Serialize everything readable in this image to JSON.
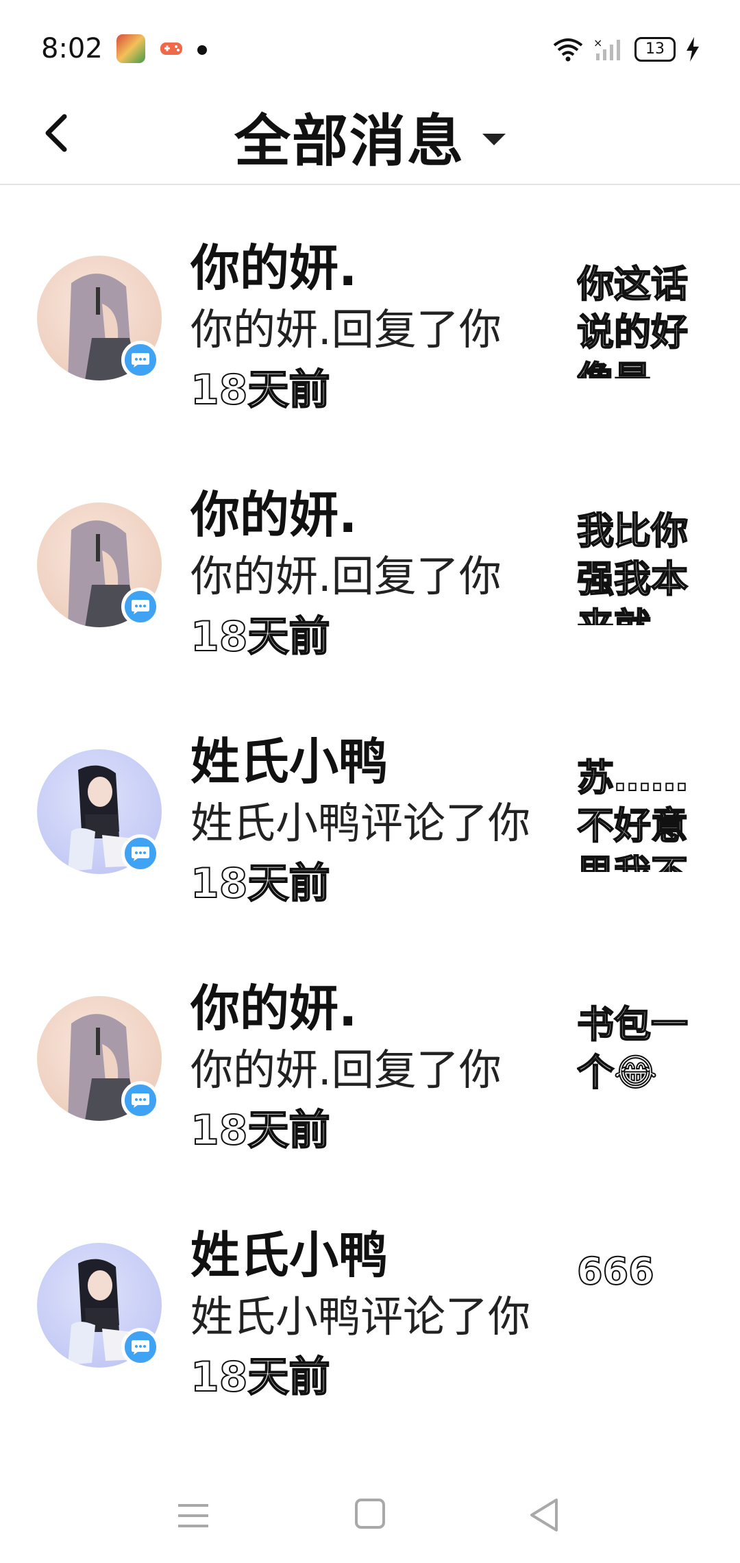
{
  "status_bar": {
    "time": "8:02",
    "battery": "13",
    "icons": [
      "app-icon-game",
      "app-icon-controller",
      "notification-dot",
      "wifi-icon",
      "no-signal-icon",
      "battery-icon",
      "charging-bolt-icon"
    ]
  },
  "header": {
    "title": "全部消息",
    "back_icon": "chevron-left-icon",
    "dropdown_icon": "caret-down-icon"
  },
  "messages": [
    {
      "name": "你的妍.",
      "action": "你的妍.回复了你",
      "time": "18天前",
      "preview": "你这话说的好像是",
      "avatar_style": "pink",
      "badge_icon": "chat-bubble-icon"
    },
    {
      "name": "你的妍.",
      "action": "你的妍.回复了你",
      "time": "18天前",
      "preview": "我比你强我本来就",
      "avatar_style": "pink",
      "badge_icon": "chat-bubble-icon"
    },
    {
      "name": "姓氏小鸭",
      "action": "姓氏小鸭评论了你",
      "time": "18天前",
      "preview": "苏……不好意思我不玩",
      "avatar_style": "blue",
      "badge_icon": "chat-bubble-icon"
    },
    {
      "name": "你的妍.",
      "action": "你的妍.回复了你",
      "time": "18天前",
      "preview": "书包一个😂",
      "avatar_style": "pink",
      "badge_icon": "chat-bubble-icon"
    },
    {
      "name": "姓氏小鸭",
      "action": "姓氏小鸭评论了你",
      "time": "18天前",
      "preview": "666",
      "avatar_style": "blue",
      "badge_icon": "chat-bubble-icon"
    }
  ],
  "nav_bar": {
    "icons": [
      "menu-icon",
      "home-square-icon",
      "back-triangle-icon"
    ]
  },
  "colors": {
    "badge_blue": "#3fa2f3",
    "divider": "#e2e2e2",
    "nav_gray": "#a9a9a9"
  }
}
